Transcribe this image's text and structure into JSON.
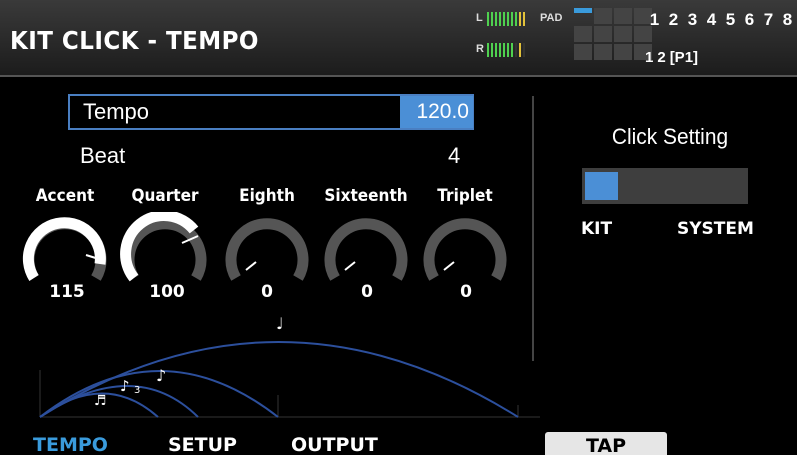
{
  "header": {
    "title": "KIT CLICK - TEMPO",
    "meter_left_label": "L",
    "meter_right_label": "R",
    "pad_label": "PAD",
    "kit_numbers": [
      "1",
      "2",
      "3",
      "4",
      "5",
      "6",
      "7",
      "8"
    ],
    "bank_numbers": [
      "1",
      "2"
    ],
    "bank_page": "[P1]"
  },
  "params": {
    "tempo_label": "Tempo",
    "tempo_value": "120.0",
    "beat_label": "Beat",
    "beat_value": "4"
  },
  "knobs": [
    {
      "label": "Accent",
      "value": "115"
    },
    {
      "label": "Quarter",
      "value": "100"
    },
    {
      "label": "Eighth",
      "value": "0"
    },
    {
      "label": "Sixteenth",
      "value": "0"
    },
    {
      "label": "Triplet",
      "value": "0"
    }
  ],
  "click_setting": {
    "title": "Click Setting",
    "options": [
      "KIT",
      "SYSTEM"
    ],
    "selected": "KIT"
  },
  "tabs": [
    "TEMPO",
    "SETUP",
    "OUTPUT"
  ],
  "active_tab": "TEMPO",
  "tap_label": "TAP",
  "colors": {
    "accent": "#4b8fd6",
    "tab_active": "#3a9bdc",
    "arc": "#2c4f9c"
  }
}
